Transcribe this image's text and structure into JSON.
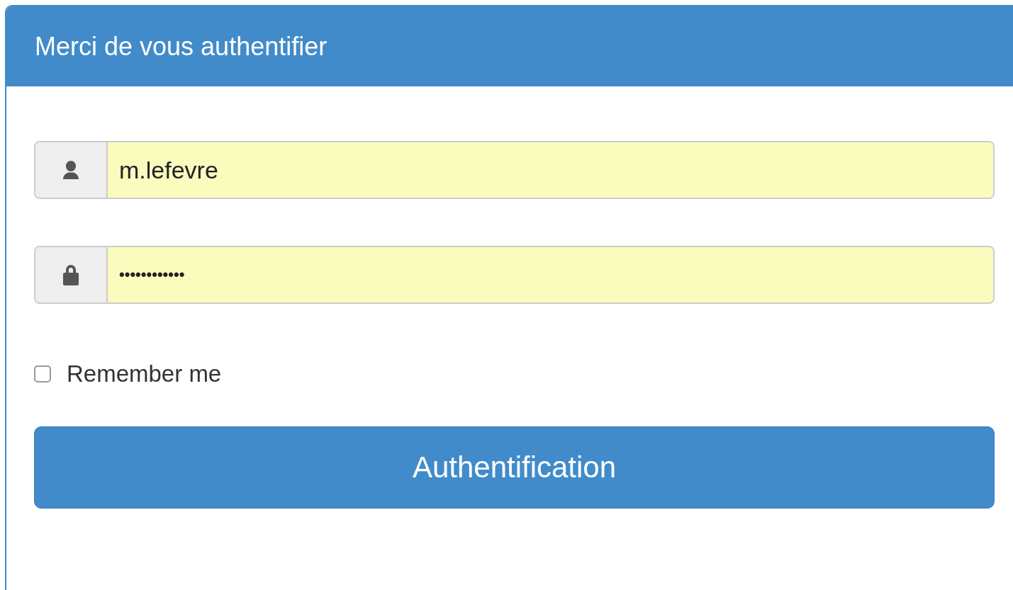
{
  "panel": {
    "title": "Merci de vous authentifier"
  },
  "fields": [
    {
      "kind": "user",
      "value": "m.lefevre"
    },
    {
      "kind": "password",
      "value": "••••••••••••"
    }
  ],
  "remember": {
    "label": "Remember me",
    "checked": false
  },
  "submit": {
    "label": "Authentification"
  }
}
